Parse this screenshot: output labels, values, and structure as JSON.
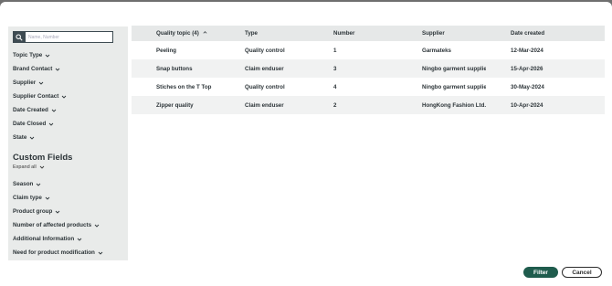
{
  "search": {
    "placeholder": "Name, Number"
  },
  "filters": [
    {
      "label": "Topic Type"
    },
    {
      "label": "Brand Contact"
    },
    {
      "label": "Supplier"
    },
    {
      "label": "Supplier Contact"
    },
    {
      "label": "Date Created"
    },
    {
      "label": "Date Closed"
    },
    {
      "label": "State"
    }
  ],
  "custom_fields": {
    "title": "Custom Fields",
    "expand_all": "Expand all",
    "items": [
      {
        "label": "Season"
      },
      {
        "label": "Claim type"
      },
      {
        "label": "Product group"
      },
      {
        "label": "Number of affected products"
      },
      {
        "label": "Additional Information"
      },
      {
        "label": "Need for product modification"
      }
    ]
  },
  "table": {
    "headers": [
      "Quality topic (4)",
      "Type",
      "Number",
      "Supplier",
      "Date created"
    ],
    "rows": [
      [
        "Peeling",
        "Quality control",
        "1",
        "Garmateks",
        "12-Mar-2024"
      ],
      [
        "Snap buttons",
        "Claim enduser",
        "3",
        "Ningbo garment supplier",
        "15-Apr-2026"
      ],
      [
        "Stiches on the T Top",
        "Quality control",
        "4",
        "Ningbo garment supplier",
        "30-May-2024"
      ],
      [
        "Zipper quality",
        "Claim enduser",
        "2",
        "HongKong Fashion Ltd.",
        "10-Apr-2024"
      ]
    ]
  },
  "buttons": {
    "filter": "Filter",
    "cancel": "Cancel"
  },
  "colors": {
    "overlay": "#6f6f6f",
    "sidebar_bg": "#e9ebea",
    "primary": "#1f5c4d",
    "search_btn": "#3e4b52"
  },
  "icons": {
    "search": "search-icon",
    "chevron": "chevron-down-icon",
    "sort": "sort-up-icon"
  }
}
